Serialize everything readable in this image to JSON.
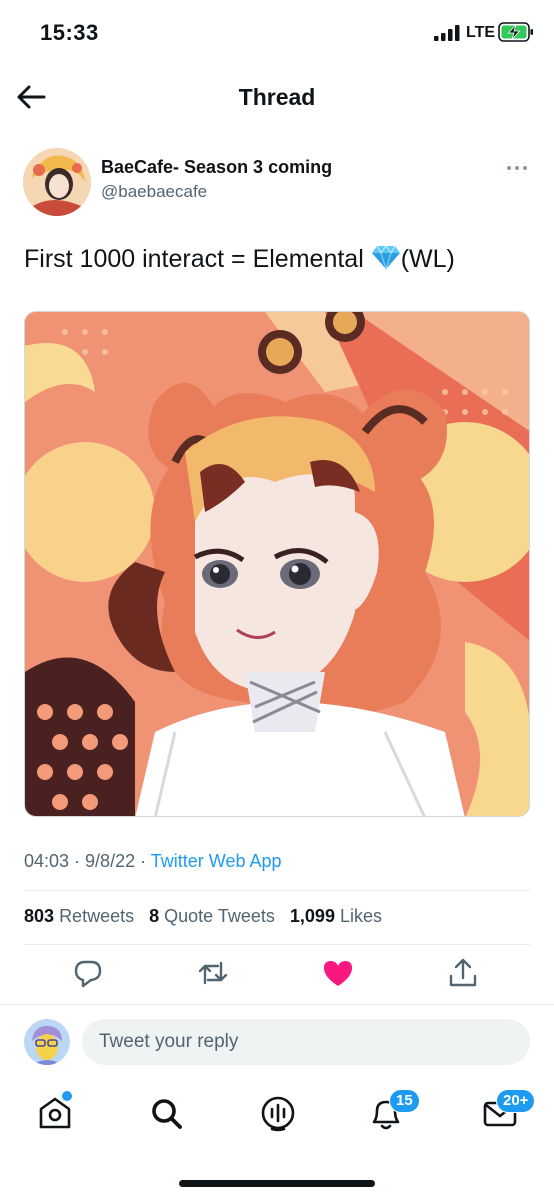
{
  "status_bar": {
    "time": "15:33",
    "network": "LTE",
    "signal_icon": "cellular-signal-icon",
    "battery_icon": "battery-charging-icon"
  },
  "header": {
    "title": "Thread",
    "back_icon": "back-arrow-icon"
  },
  "tweet": {
    "author_name": "BaeCafe- Season 3 coming",
    "author_handle": "@baebaecafe",
    "text_before": "First 1000 interact = Elemental ",
    "text_after": "(WL)",
    "emoji_icon": "gem-icon",
    "time": "04:03",
    "sep1": " · ",
    "date": "9/8/22",
    "sep2": " · ",
    "source": "Twitter Web App",
    "stats": {
      "retweets_count": "803",
      "retweets_label": "Retweets",
      "quotes_count": "8",
      "quotes_label": "Quote Tweets",
      "likes_count": "1,099",
      "likes_label": "Likes"
    },
    "actions": [
      "reply-icon",
      "retweet-icon",
      "like-icon-filled",
      "share-icon"
    ]
  },
  "reply": {
    "placeholder": "Tweet your reply"
  },
  "tabbar": {
    "items": [
      "home-icon",
      "search-icon",
      "spaces-icon",
      "notifications-icon",
      "messages-icon"
    ],
    "notifications_badge": "15",
    "messages_badge": "20+"
  },
  "colors": {
    "accent": "#1d9bf0",
    "like": "#f91880",
    "text": "#0f1419",
    "secondary": "#536471"
  }
}
